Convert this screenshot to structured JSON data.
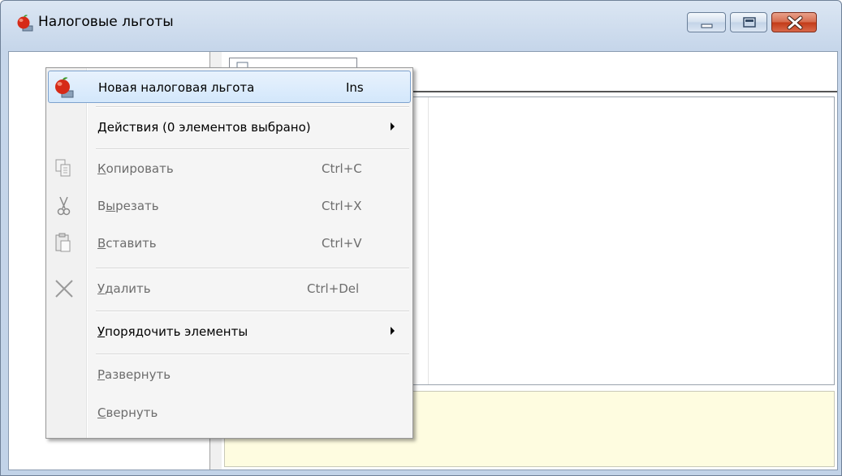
{
  "window": {
    "title": "Налоговые льготы",
    "icon": "apple-icon"
  },
  "controls": {
    "minimize": "minimize-icon",
    "maximize": "maximize-icon",
    "close": "close-icon"
  },
  "context_menu": {
    "items": [
      {
        "label": "Новая налоговая льгота",
        "shortcut": "Ins",
        "icon": "apple-icon",
        "highlighted": true,
        "enabled": true
      },
      {
        "label": "Действия (0 элементов выбрано)",
        "submenu": true,
        "enabled": true
      },
      {
        "label_underline": "К",
        "label_rest": "опировать",
        "shortcut": "Ctrl+C",
        "icon": "copy-icon",
        "enabled": false
      },
      {
        "label_pre": "В",
        "label_underline": "ы",
        "label_rest": "резать",
        "shortcut": "Ctrl+X",
        "icon": "scissors-icon",
        "enabled": false
      },
      {
        "label_underline": "В",
        "label_rest": "ставить",
        "shortcut": "Ctrl+V",
        "icon": "paste-icon",
        "enabled": false
      },
      {
        "label_underline": "У",
        "label_rest": "далить",
        "shortcut": "Ctrl+Del",
        "icon": "delete-x-icon",
        "enabled": false
      },
      {
        "label_underline": "У",
        "label_rest": "порядочить элементы",
        "submenu": true,
        "enabled": true
      },
      {
        "label_underline": "Р",
        "label_rest": "азвернуть",
        "enabled": false
      },
      {
        "label_underline": "С",
        "label_rest": "вернуть",
        "enabled": false
      }
    ]
  },
  "colors": {
    "highlight_border": "#7da2ce",
    "description_bg": "#fefce0",
    "close_button": "#c33a17"
  }
}
